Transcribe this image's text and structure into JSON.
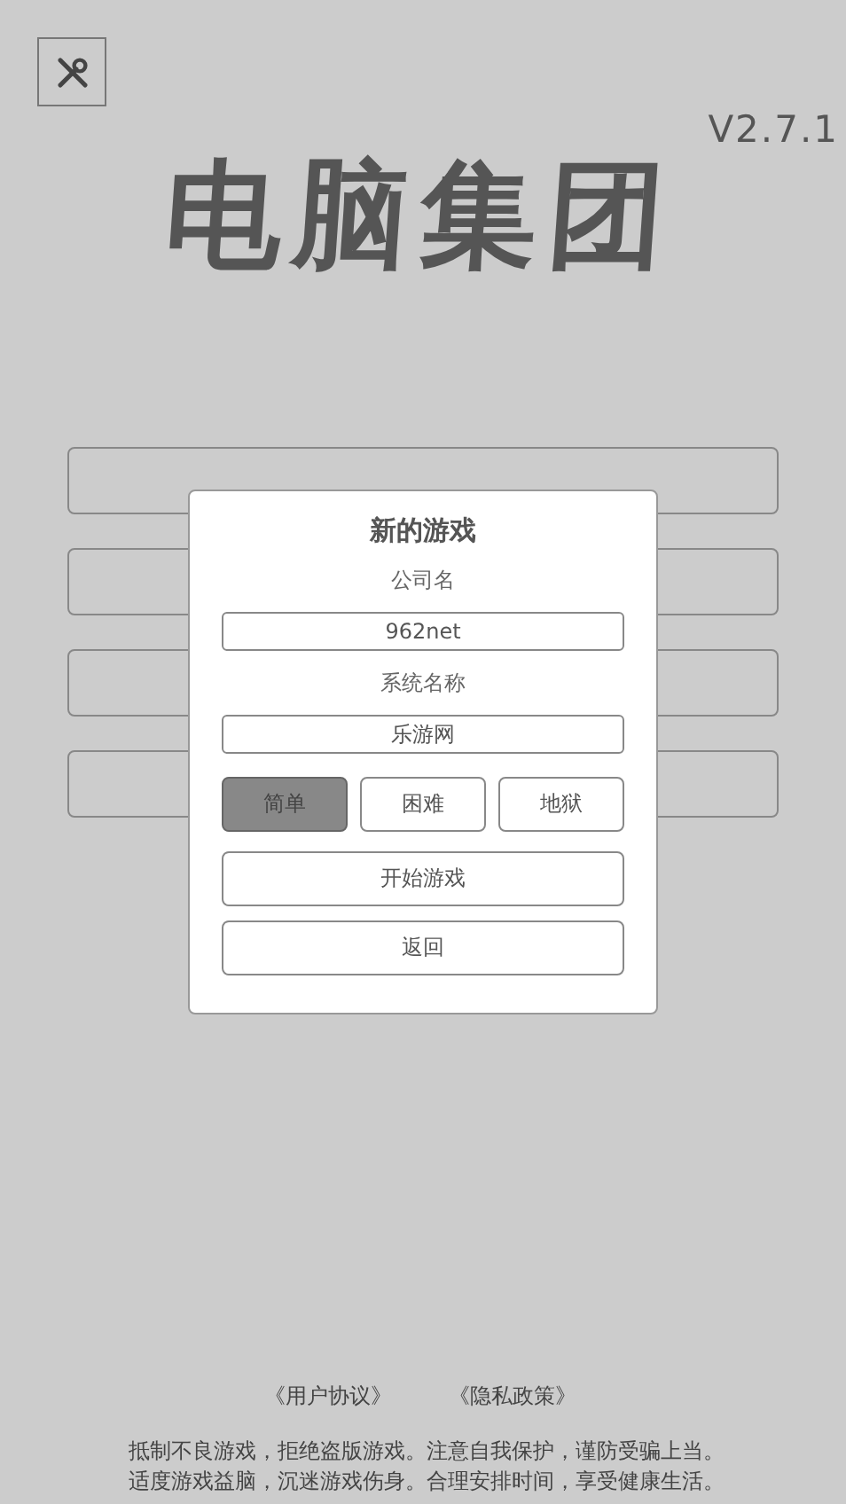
{
  "version": "V2.7.1",
  "title": "电脑集团",
  "dialog": {
    "title": "新的游戏",
    "fields": [
      {
        "label": "公司名",
        "value": "962net"
      },
      {
        "label": "系统名称",
        "value": "乐游网"
      }
    ],
    "difficulty": [
      {
        "label": "简单",
        "selected": true
      },
      {
        "label": "困难",
        "selected": false
      },
      {
        "label": "地狱",
        "selected": false
      }
    ],
    "buttons": [
      "开始游戏",
      "返回"
    ]
  },
  "footer": {
    "links": [
      "《用户协议》",
      "《隐私政策》"
    ],
    "notice": [
      "抵制不良游戏，拒绝盗版游戏。注意自我保护，谨防受骗上当。",
      "适度游戏益脑，沉迷游戏伤身。合理安排时间，享受健康生活。"
    ]
  }
}
